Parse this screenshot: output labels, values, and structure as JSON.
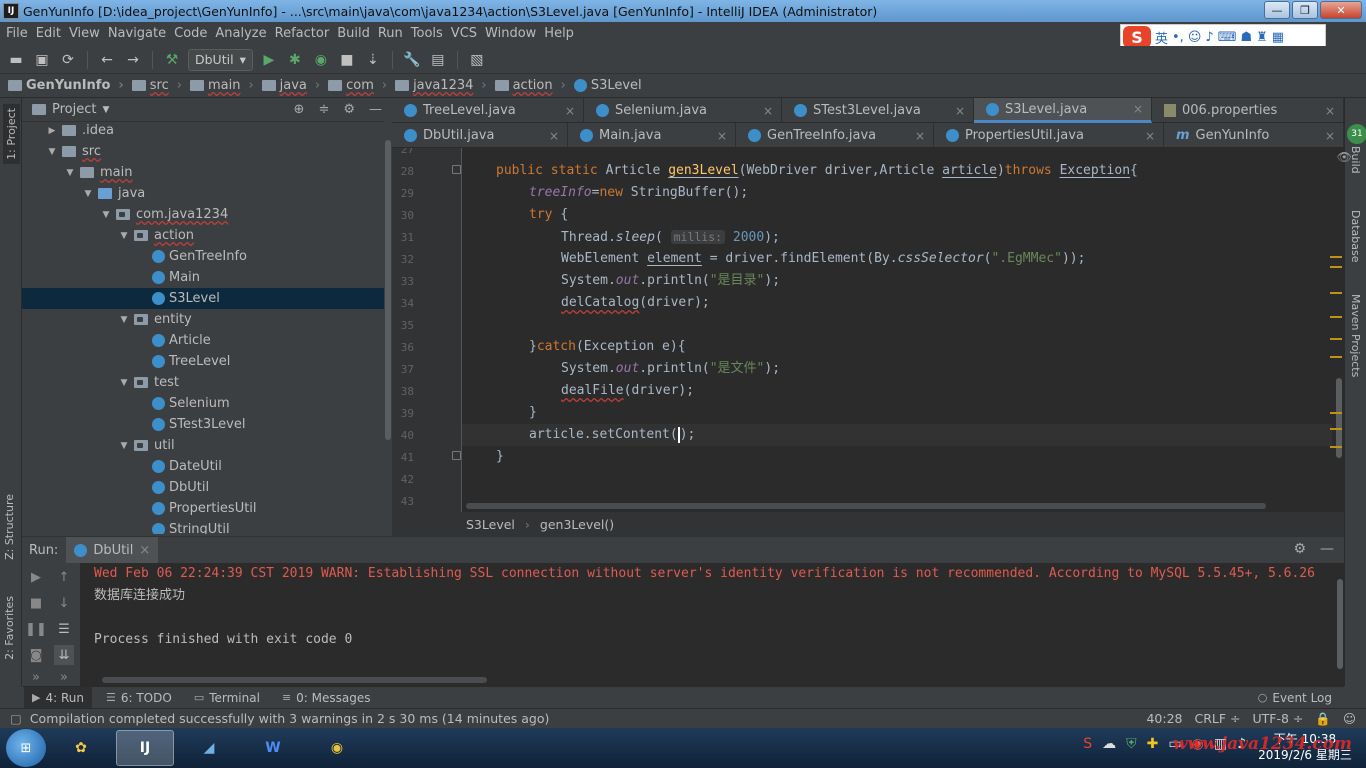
{
  "window": {
    "title": "GenYunInfo [D:\\idea_project\\GenYunInfo] - ...\\src\\main\\java\\com\\java1234\\action\\S3Level.java [GenYunInfo] - IntelliJ IDEA (Administrator)",
    "icon_label": "IJ"
  },
  "menu": [
    "File",
    "Edit",
    "View",
    "Navigate",
    "Code",
    "Analyze",
    "Refactor",
    "Build",
    "Run",
    "Tools",
    "VCS",
    "Window",
    "Help"
  ],
  "ime": {
    "logo": "S",
    "lang": "英"
  },
  "toolbar": {
    "run_config": "DbUtil"
  },
  "breadcrumb": [
    "GenYunInfo",
    "src",
    "main",
    "java",
    "com",
    "java1234",
    "action",
    "S3Level"
  ],
  "left_tabs": {
    "project": "1: Project",
    "structure": "Z: Structure",
    "favorites": "2: Favorites"
  },
  "right_tabs": {
    "build": "Build",
    "database": "Database",
    "maven": "Maven Projects",
    "badge": "31"
  },
  "project_panel": {
    "title": "Project",
    "tree": [
      {
        "label": ".idea",
        "depth": 1,
        "kind": "folder",
        "expanded": false
      },
      {
        "label": "src",
        "depth": 1,
        "kind": "folder",
        "expanded": true
      },
      {
        "label": "main",
        "depth": 2,
        "kind": "folder",
        "expanded": true
      },
      {
        "label": "java",
        "depth": 3,
        "kind": "folder-blue",
        "expanded": true
      },
      {
        "label": "com.java1234",
        "depth": 4,
        "kind": "package",
        "expanded": true
      },
      {
        "label": "action",
        "depth": 5,
        "kind": "package",
        "expanded": true
      },
      {
        "label": "GenTreeInfo",
        "depth": 6,
        "kind": "class"
      },
      {
        "label": "Main",
        "depth": 6,
        "kind": "class"
      },
      {
        "label": "S3Level",
        "depth": 6,
        "kind": "class",
        "selected": true
      },
      {
        "label": "entity",
        "depth": 5,
        "kind": "package",
        "expanded": true
      },
      {
        "label": "Article",
        "depth": 6,
        "kind": "class"
      },
      {
        "label": "TreeLevel",
        "depth": 6,
        "kind": "class"
      },
      {
        "label": "test",
        "depth": 5,
        "kind": "package",
        "expanded": true
      },
      {
        "label": "Selenium",
        "depth": 6,
        "kind": "class"
      },
      {
        "label": "STest3Level",
        "depth": 6,
        "kind": "class"
      },
      {
        "label": "util",
        "depth": 5,
        "kind": "package",
        "expanded": true
      },
      {
        "label": "DateUtil",
        "depth": 6,
        "kind": "class"
      },
      {
        "label": "DbUtil",
        "depth": 6,
        "kind": "class"
      },
      {
        "label": "PropertiesUtil",
        "depth": 6,
        "kind": "class"
      },
      {
        "label": "StringUtil",
        "depth": 6,
        "kind": "class"
      }
    ]
  },
  "editor_tabs": {
    "row1": [
      {
        "label": "TreeLevel.java",
        "icon": "class"
      },
      {
        "label": "Selenium.java",
        "icon": "class"
      },
      {
        "label": "STest3Level.java",
        "icon": "class"
      },
      {
        "label": "S3Level.java",
        "icon": "class",
        "active": true
      },
      {
        "label": "006.properties",
        "icon": "properties"
      }
    ],
    "row2": [
      {
        "label": "DbUtil.java",
        "icon": "class"
      },
      {
        "label": "Main.java",
        "icon": "class"
      },
      {
        "label": "GenTreeInfo.java",
        "icon": "class"
      },
      {
        "label": "PropertiesUtil.java",
        "icon": "class"
      },
      {
        "label": "GenYunInfo",
        "icon": "module"
      }
    ]
  },
  "code": {
    "line_numbers": [
      "27",
      "28",
      "29",
      "30",
      "31",
      "32",
      "33",
      "34",
      "35",
      "36",
      "37",
      "38",
      "39",
      "40",
      "41",
      "42",
      "43"
    ],
    "l28": {
      "a": "public static ",
      "b": "Article ",
      "c": "gen3Level",
      "d": "(WebDriver driver,Article ",
      "e": "article",
      "f": ")",
      "g": "throws ",
      "h": "Exception",
      "i": "{"
    },
    "l29": {
      "a": "treeInfo",
      "b": "=",
      "c": "new ",
      "d": "StringBuffer();"
    },
    "l30": {
      "a": "try ",
      "b": "{"
    },
    "l31": {
      "a": "Thread.",
      "b": "sleep",
      "c": "( ",
      "hint": "millis:",
      "d": " 2000",
      "e": ");"
    },
    "l32": {
      "a": "WebElement ",
      "b": "element",
      "c": " = driver.findElement(By.",
      "d": "cssSelector",
      "e": "(",
      "f": "\".EgMMec\"",
      "g": "));"
    },
    "l33": {
      "a": "System.",
      "b": "out",
      "c": ".println(",
      "d": "\"是目录\"",
      "e": ");"
    },
    "l34": {
      "a": "delCatalog",
      "b": "(driver);"
    },
    "l36": {
      "a": "}",
      "b": "catch",
      "c": "(Exception e){"
    },
    "l37": {
      "a": "System.",
      "b": "out",
      "c": ".println(",
      "d": "\"是文件\"",
      "e": ");"
    },
    "l38": {
      "a": "dealFile",
      "b": "(driver);"
    },
    "l39": {
      "a": "}"
    },
    "l40": {
      "a": "article.setContent",
      "b": "(",
      "c": ");"
    },
    "l41": {
      "a": "}"
    }
  },
  "editor_breadcrumb": [
    "S3Level",
    "gen3Level()"
  ],
  "run_panel": {
    "label": "Run:",
    "tab": "DbUtil",
    "lines": [
      "Wed Feb 06 22:24:39 CST 2019 WARN: Establishing SSL connection without server's identity verification is not recommended. According to MySQL 5.5.45+, 5.6.26",
      "数据库连接成功",
      "",
      "Process finished with exit code 0"
    ]
  },
  "bottom_tools": {
    "run": "4: Run",
    "todo": "6: TODO",
    "terminal": "Terminal",
    "messages": "0: Messages",
    "event_log": "Event Log"
  },
  "status": {
    "message": "Compilation completed successfully with 3 warnings in 2 s 30 ms (14 minutes ago)",
    "position": "40:28",
    "line_sep": "CRLF ÷",
    "encoding": "UTF-8 ÷"
  },
  "taskbar": {
    "clock_time": "下午 10:38",
    "clock_date": "2019/2/6 星期三",
    "watermark": "www.java1234.com"
  }
}
